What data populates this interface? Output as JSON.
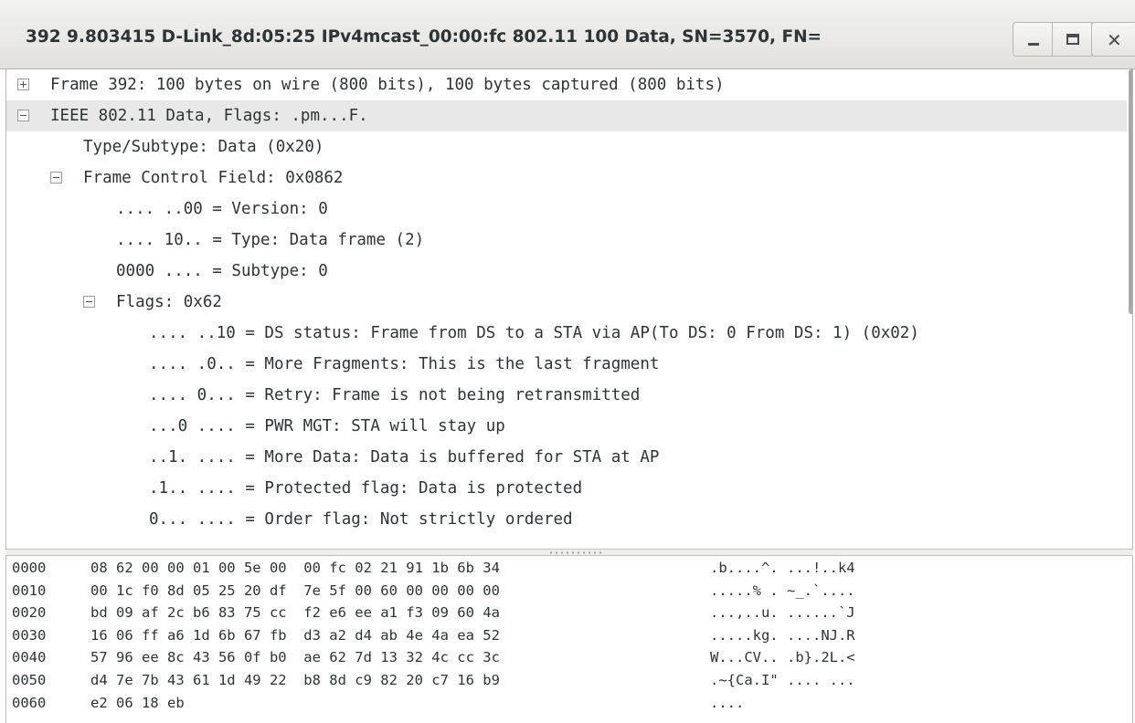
{
  "window": {
    "title": "392 9.803415 D-Link_8d:05:25 IPv4mcast_00:00:fc 802.11 100 Data, SN=3570, FN=",
    "minimize_glyph": "‒",
    "maximize_glyph": "□",
    "close_glyph": "✕"
  },
  "tree": {
    "rows": [
      {
        "text": "Frame 392: 100 bytes on wire (800 bits), 100 bytes captured (800 bits)",
        "toggle": "plus"
      },
      {
        "text": "IEEE 802.11 Data, Flags: .pm...F.",
        "toggle": "minus",
        "selected": true
      },
      {
        "text": "Type/Subtype: Data (0x20)",
        "toggle": "none"
      },
      {
        "text": "Frame Control Field: 0x0862",
        "toggle": "minus"
      },
      {
        "text": ".... ..00 = Version: 0",
        "toggle": "none"
      },
      {
        "text": ".... 10.. = Type: Data frame (2)",
        "toggle": "none"
      },
      {
        "text": "0000 .... = Subtype: 0",
        "toggle": "none"
      },
      {
        "text": "Flags: 0x62",
        "toggle": "minus"
      },
      {
        "text": ".... ..10 = DS status: Frame from DS to a STA via AP(To DS: 0 From DS: 1) (0x02)",
        "toggle": "none"
      },
      {
        "text": ".... .0.. = More Fragments: This is the last fragment",
        "toggle": "none"
      },
      {
        "text": ".... 0... = Retry: Frame is not being retransmitted",
        "toggle": "none"
      },
      {
        "text": "...0 .... = PWR MGT: STA will stay up",
        "toggle": "none"
      },
      {
        "text": "..1. .... = More Data: Data is buffered for STA at AP",
        "toggle": "none"
      },
      {
        "text": ".1.. .... = Protected flag: Data is protected",
        "toggle": "none"
      },
      {
        "text": "0... .... = Order flag: Not strictly ordered",
        "toggle": "none"
      }
    ]
  },
  "hex_dump": {
    "rows": [
      {
        "offset": "0000",
        "bytes": "08 62 00 00 01 00 5e 00  00 fc 02 21 91 1b 6b 34",
        "ascii": ".b....^. ...!..k4"
      },
      {
        "offset": "0010",
        "bytes": "00 1c f0 8d 05 25 20 df  7e 5f 00 60 00 00 00 00",
        "ascii": ".....% . ~_.`...."
      },
      {
        "offset": "0020",
        "bytes": "bd 09 af 2c b6 83 75 cc  f2 e6 ee a1 f3 09 60 4a",
        "ascii": "...,..u. ......`J"
      },
      {
        "offset": "0030",
        "bytes": "16 06 ff a6 1d 6b 67 fb  d3 a2 d4 ab 4e 4a ea 52",
        "ascii": ".....kg. ....NJ.R"
      },
      {
        "offset": "0040",
        "bytes": "57 96 ee 8c 43 56 0f b0  ae 62 7d 13 32 4c cc 3c",
        "ascii": "W...CV.. .b}.2L.<"
      },
      {
        "offset": "0050",
        "bytes": "d4 7e 7b 43 61 1d 49 22  b8 8d c9 82 20 c7 16 b9",
        "ascii": ".~{Ca.I\" .... ..."
      },
      {
        "offset": "0060",
        "bytes": "e2 06 18 eb",
        "ascii": "...."
      }
    ]
  }
}
